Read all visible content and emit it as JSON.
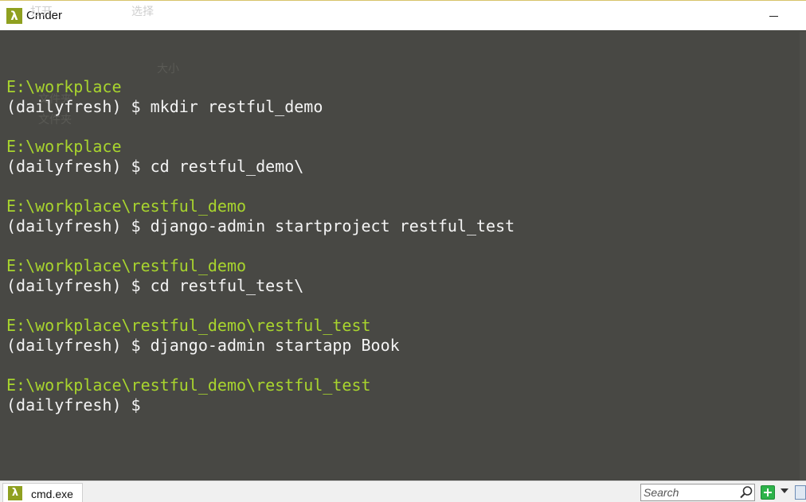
{
  "window": {
    "title": "Cmder",
    "app_icon_glyph": "λ",
    "ghost_labels": [
      "打开",
      "选择"
    ]
  },
  "terminal": {
    "path_color": "#a8d42e",
    "text_color": "#f4f4f4",
    "background": "#484844",
    "lines": [
      {
        "type": "blank",
        "text": ""
      },
      {
        "type": "path",
        "text": "E:\\workplace"
      },
      {
        "type": "cmd",
        "text": "(dailyfresh) $ mkdir restful_demo"
      },
      {
        "type": "blank",
        "text": ""
      },
      {
        "type": "path",
        "text": "E:\\workplace"
      },
      {
        "type": "cmd",
        "text": "(dailyfresh) $ cd restful_demo\\"
      },
      {
        "type": "blank",
        "text": ""
      },
      {
        "type": "path",
        "text": "E:\\workplace\\restful_demo"
      },
      {
        "type": "cmd",
        "text": "(dailyfresh) $ django-admin startproject restful_test"
      },
      {
        "type": "blank",
        "text": ""
      },
      {
        "type": "path",
        "text": "E:\\workplace\\restful_demo"
      },
      {
        "type": "cmd",
        "text": "(dailyfresh) $ cd restful_test\\"
      },
      {
        "type": "blank",
        "text": ""
      },
      {
        "type": "path",
        "text": "E:\\workplace\\restful_demo\\restful_test"
      },
      {
        "type": "cmd",
        "text": "(dailyfresh) $ django-admin startapp Book"
      },
      {
        "type": "blank",
        "text": ""
      },
      {
        "type": "path",
        "text": "E:\\workplace\\restful_demo\\restful_test"
      },
      {
        "type": "cmd",
        "text": "(dailyfresh) $ "
      }
    ],
    "background_ghost_labels": [
      "大小",
      "文件夹",
      "文件夹"
    ]
  },
  "statusbar": {
    "tab_label": "cmd.exe",
    "tab_icon_glyph": "λ",
    "search_placeholder": "Search",
    "add_color": "#2db34a"
  }
}
